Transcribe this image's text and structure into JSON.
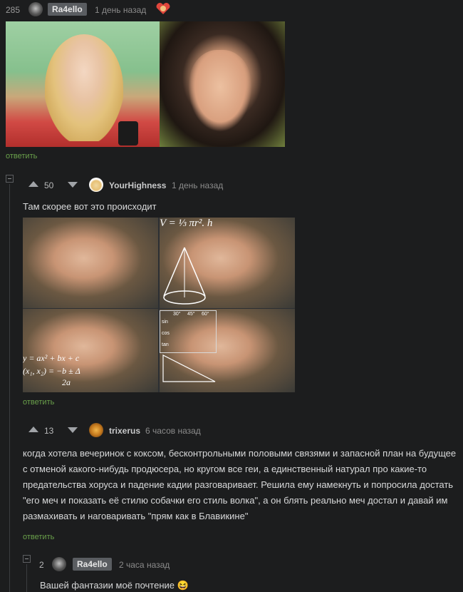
{
  "post_comment": {
    "rating": "285",
    "user": "Ra4ello",
    "time": "1 день назад",
    "reply": "ответить"
  },
  "comments": [
    {
      "score": "50",
      "user": "YourHighness",
      "time": "1 день назад",
      "text": "Там скорее вот это происходит",
      "reply": "ответить",
      "math": {
        "v": "V = ⅓ πr². h",
        "quad1": "y = ax² + bx + c",
        "quad2": "(x₁, x₂) = −b ± Δ",
        "quad3": "2a",
        "trig": [
          "sin",
          "cos",
          "tan"
        ],
        "angles": [
          "30°",
          "45°",
          "60°"
        ]
      }
    },
    {
      "score": "13",
      "user": "trixerus",
      "time": "6 часов назад",
      "text": "когда хотела вечеринок с коксом, бесконтрольными половыми связями и запасной план на будущее с отменой какого-нибудь продюсера, но кругом все геи, а единственный натурал про какие-то предательства хоруса и падение кадии разговаривает. Решила ему намекнуть и попросила достать \"его меч и показать её стилю собачки его стиль волка\", а он блять реально меч достал и давай им размахивать и наговаривать \"прям как в Блавикине\"",
      "reply": "ответить"
    },
    {
      "score": "2",
      "user": "Ra4ello",
      "time": "2 часа назад",
      "text": "Вашей фантазии моё почтение",
      "emoji": "😆"
    }
  ],
  "colors": {
    "background": "#1c1d1e",
    "reply_link": "#6aa14b",
    "user_pill": "#5a5d61"
  }
}
